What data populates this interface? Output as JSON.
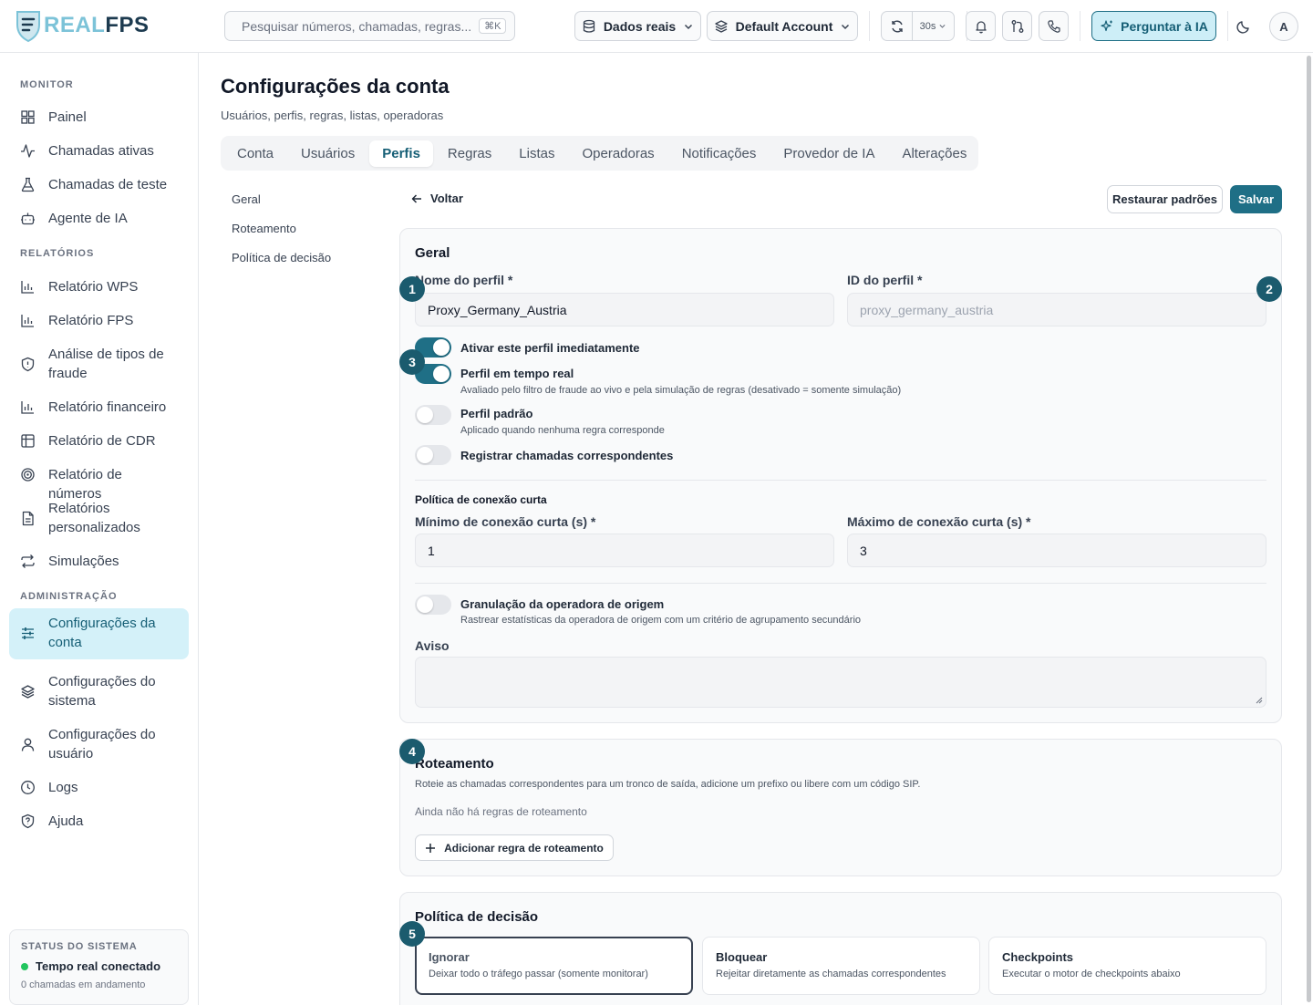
{
  "app": {
    "logo_real": "REAL",
    "logo_fps": "FPS"
  },
  "topbar": {
    "search_placeholder": "Pesquisar números, chamadas, regras...",
    "search_shortcut": "⌘K",
    "data_source": "Dados reais",
    "account": "Default Account",
    "refresh_interval": "30s",
    "ask_ai": "Perguntar à IA",
    "avatar_initial": "A"
  },
  "sidebar": {
    "sections": {
      "monitor": "MONITOR",
      "reports": "RELATÓRIOS",
      "admin": "ADMINISTRAÇÃO"
    },
    "items": {
      "painel": "Painel",
      "chamadas_ativas": "Chamadas ativas",
      "chamadas_teste": "Chamadas de teste",
      "agente_ia": "Agente de IA",
      "rel_wps": "Relatório WPS",
      "rel_fps": "Relatório FPS",
      "analise_fraude": "Análise de tipos de fraude",
      "rel_financeiro": "Relatório financeiro",
      "rel_cdr": "Relatório de CDR",
      "rel_numeros": "Relatório de números",
      "rel_personalizados": "Relatórios personalizados",
      "simulacoes": "Simulações",
      "config_conta": "Configurações da conta",
      "config_sistema": "Configurações do sistema",
      "config_usuario": "Configurações do usuário",
      "logs": "Logs",
      "ajuda": "Ajuda"
    },
    "status": {
      "title": "STATUS DO SISTEMA",
      "state": "Tempo real conectado",
      "calls": "0 chamadas em andamento"
    }
  },
  "page": {
    "title": "Configurações da conta",
    "subtitle": "Usuários, perfis, regras, listas, operadoras",
    "tabs": [
      "Conta",
      "Usuários",
      "Perfis",
      "Regras",
      "Listas",
      "Operadoras",
      "Notificações",
      "Provedor de IA",
      "Alterações"
    ],
    "active_tab": "Perfis",
    "subnav": [
      "Geral",
      "Roteamento",
      "Política de decisão"
    ],
    "back": "Voltar",
    "restore": "Restaurar padrões",
    "save": "Salvar"
  },
  "general": {
    "title": "Geral",
    "profile_name_label": "Nome do perfil *",
    "profile_name_value": "Proxy_Germany_Austria",
    "profile_id_label": "ID do perfil *",
    "profile_id_value": "proxy_germany_austria",
    "toggles": [
      {
        "label": "Ativar este perfil imediatamente",
        "desc": "",
        "on": true
      },
      {
        "label": "Perfil em tempo real",
        "desc": "Avaliado pelo filtro de fraude ao vivo e pela simulação de regras (desativado = somente simulação)",
        "on": true
      },
      {
        "label": "Perfil padrão",
        "desc": "Aplicado quando nenhuma regra corresponde",
        "on": false
      },
      {
        "label": "Registrar chamadas correspondentes",
        "desc": "",
        "on": false
      }
    ],
    "short_conn_title": "Política de conexão curta",
    "min_label": "Mínimo de conexão curta (s) *",
    "min_value": "1",
    "max_label": "Máximo de conexão curta (s) *",
    "max_value": "3",
    "granulation_label": "Granulação da operadora de origem",
    "granulation_desc": "Rastrear estatísticas da operadora de origem com um critério de agrupamento secundário",
    "granulation_on": false,
    "notice_label": "Aviso",
    "notice_value": ""
  },
  "routing": {
    "title": "Roteamento",
    "desc": "Roteie as chamadas correspondentes para um tronco de saída, adicione um prefixo ou libere com um código SIP.",
    "empty": "Ainda não há regras de roteamento",
    "add": "Adicionar regra de roteamento"
  },
  "decision": {
    "title": "Política de decisão",
    "options": [
      {
        "title": "Ignorar",
        "desc": "Deixar todo o tráfego passar (somente monitorar)",
        "selected": true
      },
      {
        "title": "Bloquear",
        "desc": "Rejeitar diretamente as chamadas correspondentes",
        "selected": false
      },
      {
        "title": "Checkpoints",
        "desc": "Executar o motor de checkpoints abaixo",
        "selected": false
      }
    ]
  },
  "badges": [
    "1",
    "2",
    "3",
    "4",
    "5"
  ],
  "colors": {
    "accent": "#1f6f86",
    "accent_light": "#d4f1f9",
    "status_ok": "#22c55e"
  }
}
